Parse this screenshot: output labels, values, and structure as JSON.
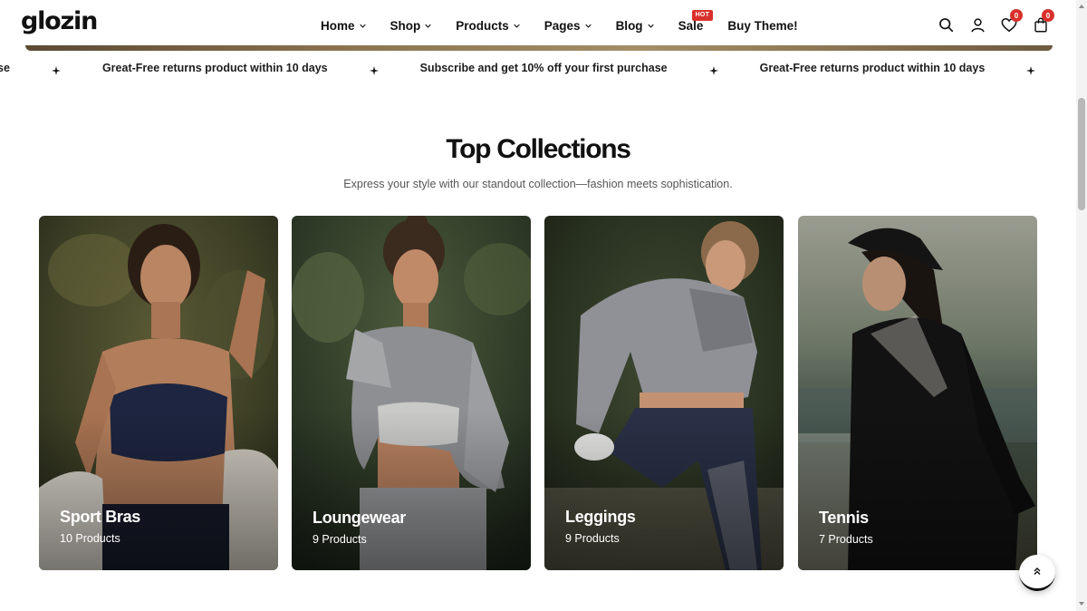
{
  "header": {
    "logo": "glozin",
    "nav": [
      {
        "label": "Home",
        "has_dropdown": true
      },
      {
        "label": "Shop",
        "has_dropdown": true
      },
      {
        "label": "Products",
        "has_dropdown": true
      },
      {
        "label": "Pages",
        "has_dropdown": true
      },
      {
        "label": "Blog",
        "has_dropdown": true
      },
      {
        "label": "Sale",
        "has_dropdown": false,
        "badge": "HOT"
      },
      {
        "label": "Buy Theme!",
        "has_dropdown": false
      }
    ],
    "icons": {
      "search": "search-icon",
      "account": "user-icon",
      "wishlist": "heart-icon",
      "wishlist_count": "0",
      "cart": "bag-icon",
      "cart_count": "0"
    }
  },
  "marquee": {
    "items": [
      "urchase",
      "Great-Free returns product within 10 days",
      "Subscribe and get 10% off your first purchase",
      "Great-Free returns product within 10 days"
    ]
  },
  "collections": {
    "title": "Top Collections",
    "subtitle": "Express your style with our standout collection—fashion meets sophistication.",
    "cards": [
      {
        "title": "Sport Bras",
        "count": "10 Products"
      },
      {
        "title": "Loungewear",
        "count": "9 Products"
      },
      {
        "title": "Leggings",
        "count": "9 Products"
      },
      {
        "title": "Tennis",
        "count": "7 Products"
      }
    ]
  },
  "colors": {
    "accent": "#d9312b",
    "text": "#111111",
    "muted": "#555555"
  }
}
